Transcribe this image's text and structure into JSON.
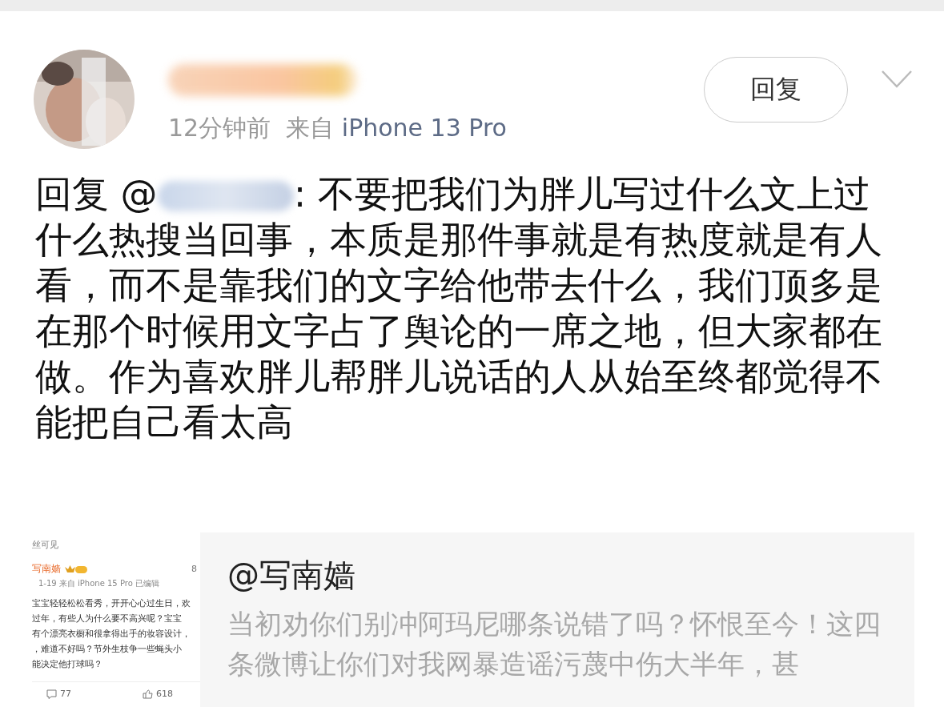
{
  "comment": {
    "time": "12分钟前",
    "source_prefix": "来自",
    "device": "iPhone 13 Pro",
    "reply_button": "回复",
    "reply_prefix": "回复 @",
    "text": ": 不要把我们为胖儿写过什么文上过什么热搜当回事，本质是那件事就是有热度就是有人看，而不是靠我们的文字给他带去什么，我们顶多是在那个时候用文字占了舆论的一席之地，但大家都在做。作为喜欢胖儿帮胖儿说话的人从始至终都觉得不能把自己看太高"
  },
  "quote": {
    "thumbnail": {
      "visibility": "丝可见",
      "author": "写南嫱",
      "meta": "1-19  来自 iPhone 15 Pro  已编辑",
      "side_count": "8",
      "lines": [
        "宝宝轻轻松松看秀，开开心心过生日，欢",
        "过年，有些人为什么要不高兴呢？宝宝",
        "有个漂亮衣橱和很拿得出手的妆容设计，",
        "，难道不好吗？节外生枝争一些蝇头小",
        "能决定他打球吗？"
      ],
      "comments": "77",
      "likes": "618"
    },
    "title": "@写南嫱",
    "text": "当初劝你们别冲阿玛尼哪条说错了吗？怀恨至今！这四条微博让你们对我网暴造谣污蔑中伤大半年，甚"
  }
}
